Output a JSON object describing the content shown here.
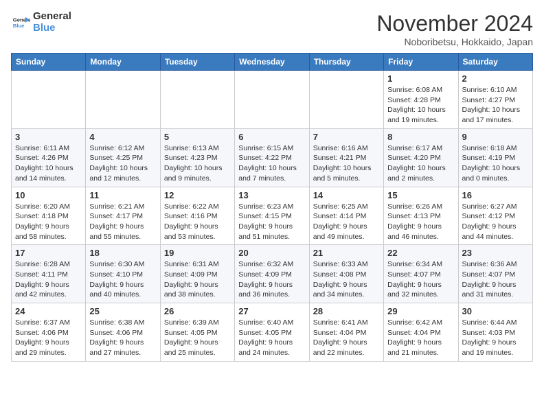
{
  "header": {
    "logo_line1": "General",
    "logo_line2": "Blue",
    "month_title": "November 2024",
    "location": "Noboribetsu, Hokkaido, Japan"
  },
  "weekdays": [
    "Sunday",
    "Monday",
    "Tuesday",
    "Wednesday",
    "Thursday",
    "Friday",
    "Saturday"
  ],
  "weeks": [
    [
      {
        "day": "",
        "info": ""
      },
      {
        "day": "",
        "info": ""
      },
      {
        "day": "",
        "info": ""
      },
      {
        "day": "",
        "info": ""
      },
      {
        "day": "",
        "info": ""
      },
      {
        "day": "1",
        "info": "Sunrise: 6:08 AM\nSunset: 4:28 PM\nDaylight: 10 hours and 19 minutes."
      },
      {
        "day": "2",
        "info": "Sunrise: 6:10 AM\nSunset: 4:27 PM\nDaylight: 10 hours and 17 minutes."
      }
    ],
    [
      {
        "day": "3",
        "info": "Sunrise: 6:11 AM\nSunset: 4:26 PM\nDaylight: 10 hours and 14 minutes."
      },
      {
        "day": "4",
        "info": "Sunrise: 6:12 AM\nSunset: 4:25 PM\nDaylight: 10 hours and 12 minutes."
      },
      {
        "day": "5",
        "info": "Sunrise: 6:13 AM\nSunset: 4:23 PM\nDaylight: 10 hours and 9 minutes."
      },
      {
        "day": "6",
        "info": "Sunrise: 6:15 AM\nSunset: 4:22 PM\nDaylight: 10 hours and 7 minutes."
      },
      {
        "day": "7",
        "info": "Sunrise: 6:16 AM\nSunset: 4:21 PM\nDaylight: 10 hours and 5 minutes."
      },
      {
        "day": "8",
        "info": "Sunrise: 6:17 AM\nSunset: 4:20 PM\nDaylight: 10 hours and 2 minutes."
      },
      {
        "day": "9",
        "info": "Sunrise: 6:18 AM\nSunset: 4:19 PM\nDaylight: 10 hours and 0 minutes."
      }
    ],
    [
      {
        "day": "10",
        "info": "Sunrise: 6:20 AM\nSunset: 4:18 PM\nDaylight: 9 hours and 58 minutes."
      },
      {
        "day": "11",
        "info": "Sunrise: 6:21 AM\nSunset: 4:17 PM\nDaylight: 9 hours and 55 minutes."
      },
      {
        "day": "12",
        "info": "Sunrise: 6:22 AM\nSunset: 4:16 PM\nDaylight: 9 hours and 53 minutes."
      },
      {
        "day": "13",
        "info": "Sunrise: 6:23 AM\nSunset: 4:15 PM\nDaylight: 9 hours and 51 minutes."
      },
      {
        "day": "14",
        "info": "Sunrise: 6:25 AM\nSunset: 4:14 PM\nDaylight: 9 hours and 49 minutes."
      },
      {
        "day": "15",
        "info": "Sunrise: 6:26 AM\nSunset: 4:13 PM\nDaylight: 9 hours and 46 minutes."
      },
      {
        "day": "16",
        "info": "Sunrise: 6:27 AM\nSunset: 4:12 PM\nDaylight: 9 hours and 44 minutes."
      }
    ],
    [
      {
        "day": "17",
        "info": "Sunrise: 6:28 AM\nSunset: 4:11 PM\nDaylight: 9 hours and 42 minutes."
      },
      {
        "day": "18",
        "info": "Sunrise: 6:30 AM\nSunset: 4:10 PM\nDaylight: 9 hours and 40 minutes."
      },
      {
        "day": "19",
        "info": "Sunrise: 6:31 AM\nSunset: 4:09 PM\nDaylight: 9 hours and 38 minutes."
      },
      {
        "day": "20",
        "info": "Sunrise: 6:32 AM\nSunset: 4:09 PM\nDaylight: 9 hours and 36 minutes."
      },
      {
        "day": "21",
        "info": "Sunrise: 6:33 AM\nSunset: 4:08 PM\nDaylight: 9 hours and 34 minutes."
      },
      {
        "day": "22",
        "info": "Sunrise: 6:34 AM\nSunset: 4:07 PM\nDaylight: 9 hours and 32 minutes."
      },
      {
        "day": "23",
        "info": "Sunrise: 6:36 AM\nSunset: 4:07 PM\nDaylight: 9 hours and 31 minutes."
      }
    ],
    [
      {
        "day": "24",
        "info": "Sunrise: 6:37 AM\nSunset: 4:06 PM\nDaylight: 9 hours and 29 minutes."
      },
      {
        "day": "25",
        "info": "Sunrise: 6:38 AM\nSunset: 4:06 PM\nDaylight: 9 hours and 27 minutes."
      },
      {
        "day": "26",
        "info": "Sunrise: 6:39 AM\nSunset: 4:05 PM\nDaylight: 9 hours and 25 minutes."
      },
      {
        "day": "27",
        "info": "Sunrise: 6:40 AM\nSunset: 4:05 PM\nDaylight: 9 hours and 24 minutes."
      },
      {
        "day": "28",
        "info": "Sunrise: 6:41 AM\nSunset: 4:04 PM\nDaylight: 9 hours and 22 minutes."
      },
      {
        "day": "29",
        "info": "Sunrise: 6:42 AM\nSunset: 4:04 PM\nDaylight: 9 hours and 21 minutes."
      },
      {
        "day": "30",
        "info": "Sunrise: 6:44 AM\nSunset: 4:03 PM\nDaylight: 9 hours and 19 minutes."
      }
    ]
  ]
}
